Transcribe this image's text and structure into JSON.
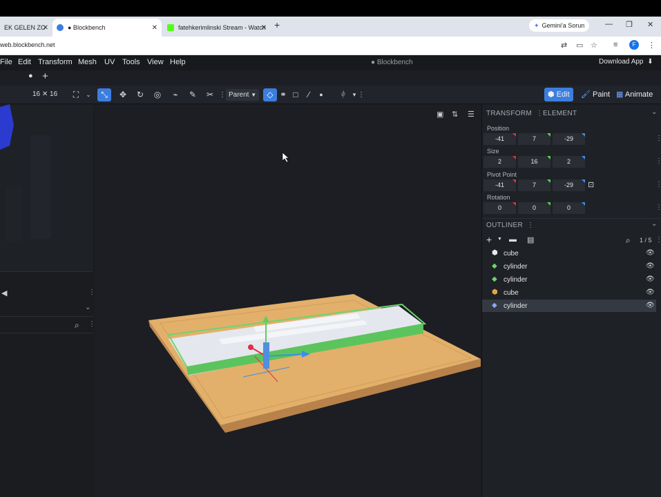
{
  "browser": {
    "tabs": [
      {
        "title": "EK GELEN ZO",
        "active": false
      },
      {
        "title": "● Blockbench",
        "active": true
      },
      {
        "title": "fatehkerimlinski Stream - Watch",
        "active": false
      }
    ],
    "new_tab": "+",
    "gemini_button": "Gemini'a Sorun",
    "url": "web.blockbench.net",
    "avatar_letter": "F"
  },
  "app": {
    "menu": [
      "File",
      "Edit",
      "Transform",
      "Mesh",
      "UV",
      "Tools",
      "View",
      "Help"
    ],
    "title": "● Blockbench",
    "download": "Download App",
    "grid_size": "16 ✕ 16",
    "pivot_mode": "Parent",
    "modes": {
      "edit": "Edit",
      "paint": "Paint",
      "animate": "Animate"
    }
  },
  "transform": {
    "header": "TRANSFORM",
    "header2": "ELEMENT",
    "position_label": "Position",
    "position": [
      "-41",
      "7",
      "-29"
    ],
    "size_label": "Size",
    "size": [
      "2",
      "16",
      "2"
    ],
    "pivot_label": "Pivot Point",
    "pivot": [
      "-41",
      "7",
      "-29"
    ],
    "rotation_label": "Rotation",
    "rotation": [
      "0",
      "0",
      "0"
    ]
  },
  "outliner": {
    "header": "OUTLINER",
    "count": "1 / 5",
    "items": [
      {
        "name": "cube",
        "icon": "cube-icon"
      },
      {
        "name": "cylinder",
        "icon": "mesh-icon"
      },
      {
        "name": "cylinder",
        "icon": "mesh-icon"
      },
      {
        "name": "cube",
        "icon": "cube-icon"
      },
      {
        "name": "cylinder",
        "icon": "mesh-icon"
      }
    ]
  },
  "colors": {
    "accent": "#3c7ee0",
    "x_axis": "#e0304a",
    "y_axis": "#5bd15b",
    "z_axis": "#3d8ee8",
    "wood": "#e2b06a",
    "selection_green": "#6fd46f"
  }
}
